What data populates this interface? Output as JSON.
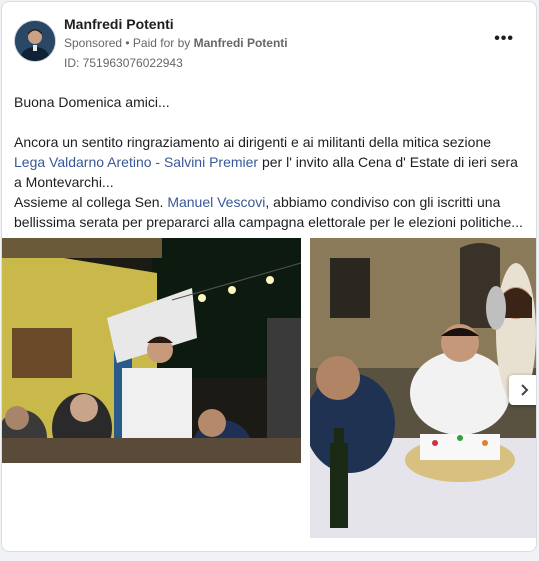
{
  "post": {
    "author": "Manfredi Potenti",
    "sponsored_label": "Sponsored",
    "separator": " • ",
    "paid_for_prefix": "Paid for by ",
    "paid_for_name": "Manfredi Potenti",
    "ad_id": "ID: 751963076022943",
    "more_icon": "more-options-icon",
    "text": {
      "greeting": "Buona Domenica amici...",
      "line1": "Ancora un sentito ringraziamento ai dirigenti e ai militanti della mitica sezione",
      "link1": "Lega Valdarno Aretino - Salvini Premier",
      "line2": " per l' invito alla Cena d' Estate di ieri sera a Montevarchi...",
      "line3_prefix": "Assieme al collega Sen. ",
      "link2": "Manuel Vescovi",
      "line3_suffix": ", abbiamo condiviso con gli iscritti una bellissima serata per prepararci alla campagna elettorale per le elezioni politiche..."
    }
  },
  "gallery": {
    "photos": [
      "dinner-photo-speaker",
      "dinner-photo-cake"
    ],
    "next_icon": "chevron-right-icon"
  },
  "colors": {
    "link": "#385898",
    "meta": "#65676b"
  }
}
